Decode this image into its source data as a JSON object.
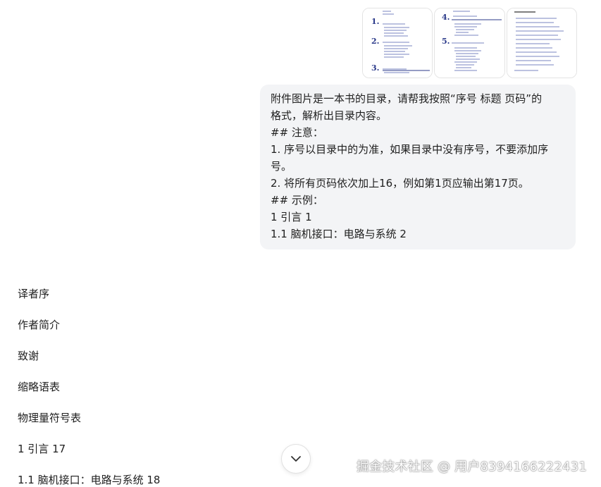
{
  "attachments": {
    "thumbnails": [
      {
        "icon": "book-toc-page-1"
      },
      {
        "icon": "book-toc-page-2"
      },
      {
        "icon": "book-toc-page-3"
      }
    ]
  },
  "user_message": {
    "lines": [
      "附件图片是一本书的目录，请帮我按照“序号 标题 页码”的",
      "格式，解析出目录内容。",
      "## 注意：",
      "1. 序号以目录中的为准，如果目录中没有序号，不要添加序",
      "号。",
      "2. 将所有页码依次加上16，例如第1页应输出第17页。",
      "## 示例：",
      "1 引言 1",
      "1.1 脑机接口：电路与系统 2"
    ]
  },
  "assistant_answer": {
    "lines": [
      "译者序",
      "作者简介",
      "致谢",
      "缩略语表",
      "物理量符号表",
      "1 引言 17",
      "1.1 脑机接口：电路与系统 18"
    ]
  },
  "scroll_button": {
    "icon": "chevron-down-icon"
  },
  "watermark": {
    "text": "掘金技术社区 @ 用户8394166222431"
  }
}
